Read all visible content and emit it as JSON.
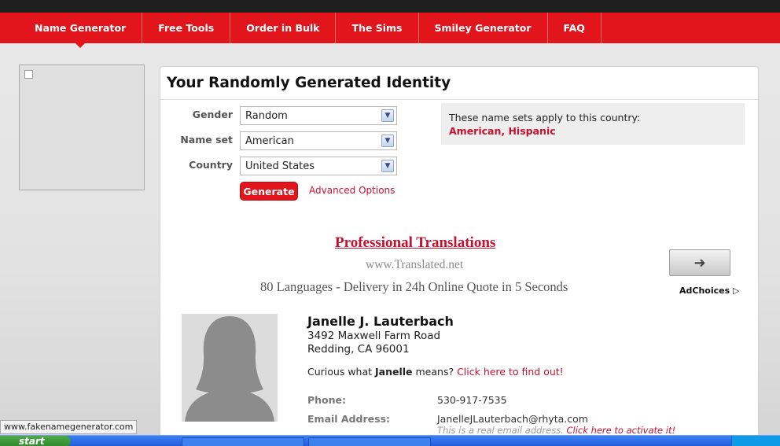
{
  "nav": {
    "items": [
      {
        "label": "Name Generator",
        "active": true
      },
      {
        "label": "Free Tools",
        "active": false
      },
      {
        "label": "Order in Bulk",
        "active": false
      },
      {
        "label": "The Sims",
        "active": false
      },
      {
        "label": "Smiley Generator",
        "active": false
      },
      {
        "label": "FAQ",
        "active": false
      }
    ]
  },
  "panel": {
    "title": "Your Randomly Generated Identity"
  },
  "form": {
    "gender_label": "Gender",
    "gender_value": "Random",
    "nameset_label": "Name set",
    "nameset_value": "American",
    "country_label": "Country",
    "country_value": "United States",
    "generate_label": "Generate",
    "advanced_label": "Advanced Options"
  },
  "info": {
    "text": "These name sets apply to this country:",
    "countries": "American, Hispanic"
  },
  "ad": {
    "title": "Professional Translations",
    "url": "www.Translated.net",
    "description": "80 Languages - Delivery in 24h Online Quote in 5 Seconds",
    "arrow_icon": "right-arrow-icon",
    "adchoices": "AdChoices ▷"
  },
  "identity": {
    "name": "Janelle J. Lauterbach",
    "address_line1": "3492 Maxwell Farm Road",
    "address_line2": "Redding, CA 96001",
    "curious_prefix": "Curious what ",
    "curious_name": "Janelle",
    "curious_mid": " means? ",
    "curious_link": "Click here to find out!",
    "phone_label": "Phone:",
    "phone": "530-917-7535",
    "email_label": "Email Address:",
    "email": "JanelleJLauterbach@rhyta.com",
    "email_note": "This is a real email address. ",
    "email_note_link": "Click here to activate it!"
  },
  "status_bar": {
    "url": "www.fakenamegenerator.com"
  },
  "taskbar": {
    "start_label": "start"
  },
  "colors": {
    "brand_red": "#e3151c",
    "link_red": "#c8102e"
  }
}
